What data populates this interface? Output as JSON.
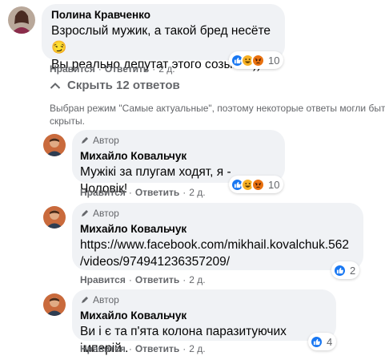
{
  "comment": {
    "author": "Полина Кравченко",
    "text_line1": "Взрослый мужик, а такой бред несёте 😏",
    "text_line2": "Вы реально депутат этого созыва?))",
    "like_label": "Нравится",
    "reply_label": "Ответить",
    "time": "2 д.",
    "reaction_count": "10",
    "reactions": [
      "like-icon",
      "haha-icon",
      "angry-icon"
    ]
  },
  "replies_toggle": {
    "label": "Скрыть 12 ответов"
  },
  "notice": "Выбран режим \"Самые актуальные\", поэтому некоторые ответы могли быть скрыты.",
  "replies": [
    {
      "badge": "Автор",
      "author": "Михайло Ковальчук",
      "text": "Мужікі за плугам ходят, я - Чоловік!",
      "like_label": "Нравится",
      "reply_label": "Ответить",
      "time": "2 д.",
      "reaction_count": "10",
      "reactions": [
        "like-icon",
        "haha-icon",
        "angry-icon"
      ]
    },
    {
      "badge": "Автор",
      "author": "Михайло Ковальчук",
      "text_line1": "https://www.facebook.com/mikhail.kovalchuk.562",
      "text_line2": "/videos/974941236357209/",
      "like_label": "Нравится",
      "reply_label": "Ответить",
      "time": "2 д.",
      "reaction_count": "2",
      "reactions": [
        "like-icon"
      ]
    },
    {
      "badge": "Автор",
      "author": "Михайло Ковальчук",
      "text": "Ви і є та п'ята колона паразитуючих імперій .",
      "like_label": "Нравится",
      "reply_label": "Ответить",
      "time": "2 д.",
      "reaction_count": "4",
      "reactions": [
        "like-icon"
      ]
    }
  ],
  "colors": {
    "bubble": "#f0f2f5",
    "secondary_text": "#65676b",
    "like_blue": "#1877f2"
  }
}
